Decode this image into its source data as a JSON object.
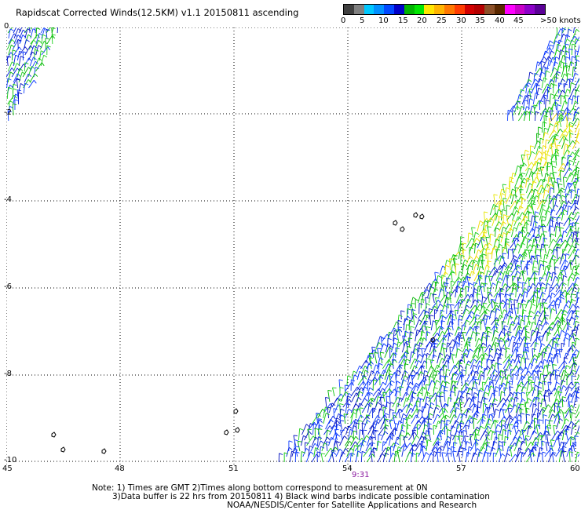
{
  "title": "Rapidscat Corrected Winds(12.5KM) v1.1 20150811 ascending",
  "colorbar": {
    "colors": [
      "#404040",
      "#808080",
      "#00c8ff",
      "#0090ff",
      "#0048ff",
      "#0000c8",
      "#00b400",
      "#00e600",
      "#ffe600",
      "#ffb400",
      "#ff7800",
      "#ff3c00",
      "#d20000",
      "#b40000",
      "#8c5028",
      "#5a2800",
      "#ff00ff",
      "#c800c8",
      "#8c00c8",
      "#5a0096"
    ],
    "labels": [
      "0",
      "5",
      "10",
      "15",
      "20",
      "25",
      "30",
      "35",
      "40",
      "45",
      ">50 knots"
    ]
  },
  "axes": {
    "x_ticks": [
      "45",
      "48",
      "51",
      "54",
      "57",
      "60"
    ],
    "y_ticks": [
      "0",
      "-2",
      "-4",
      "-6",
      "-8",
      "-10"
    ]
  },
  "pass_time": "9:31",
  "notes": [
    "Note: 1) Times are GMT 2)Times along bottom correspond to measurement at 0N",
    "3)Data buffer is 22 hrs from 20150811 4) Black wind barbs indicate possible contamination",
    "NOAA/NESDIS/Center for Satellite Applications and Research"
  ]
}
